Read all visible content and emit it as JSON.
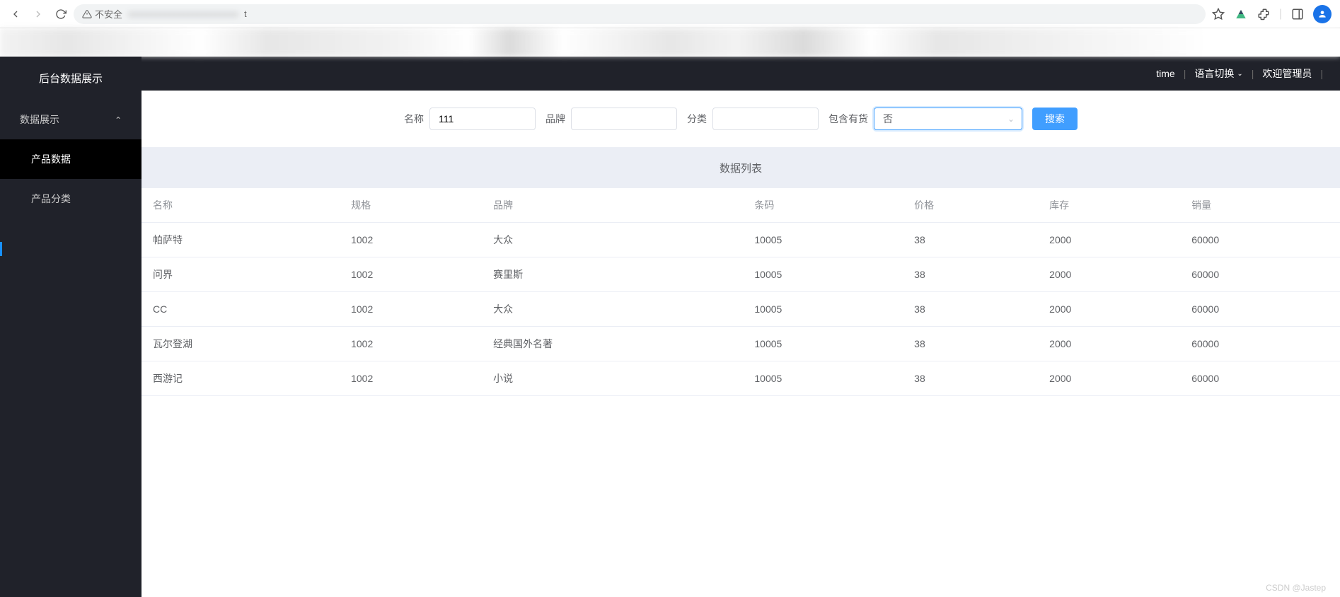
{
  "browser": {
    "insecure_label": "不安全",
    "url_suffix": "t"
  },
  "sidebar": {
    "title": "后台数据展示",
    "items": [
      {
        "label": "数据展示",
        "expandable": true
      },
      {
        "label": "产品数据",
        "active": true
      },
      {
        "label": "产品分类"
      }
    ]
  },
  "header": {
    "time": "time",
    "lang_switch": "语言切换",
    "welcome": "欢迎管理员"
  },
  "search": {
    "name_label": "名称",
    "name_value": "111",
    "brand_label": "品牌",
    "brand_value": "",
    "category_label": "分类",
    "category_value": "",
    "instock_label": "包含有货",
    "instock_value": "否",
    "button": "搜索"
  },
  "table": {
    "title": "数据列表",
    "columns": [
      "名称",
      "规格",
      "品牌",
      "条码",
      "价格",
      "库存",
      "销量"
    ],
    "rows": [
      {
        "name": "帕萨特",
        "spec": "1002",
        "brand": "大众",
        "barcode": "10005",
        "price": "38",
        "stock": "2000",
        "sales": "60000"
      },
      {
        "name": "问界",
        "spec": "1002",
        "brand": "赛里斯",
        "barcode": "10005",
        "price": "38",
        "stock": "2000",
        "sales": "60000"
      },
      {
        "name": "CC",
        "spec": "1002",
        "brand": "大众",
        "barcode": "10005",
        "price": "38",
        "stock": "2000",
        "sales": "60000"
      },
      {
        "name": "瓦尔登湖",
        "spec": "1002",
        "brand": "经典国外名著",
        "barcode": "10005",
        "price": "38",
        "stock": "2000",
        "sales": "60000"
      },
      {
        "name": "西游记",
        "spec": "1002",
        "brand": "小说",
        "barcode": "10005",
        "price": "38",
        "stock": "2000",
        "sales": "60000"
      }
    ]
  },
  "watermark": "CSDN @Jastep"
}
